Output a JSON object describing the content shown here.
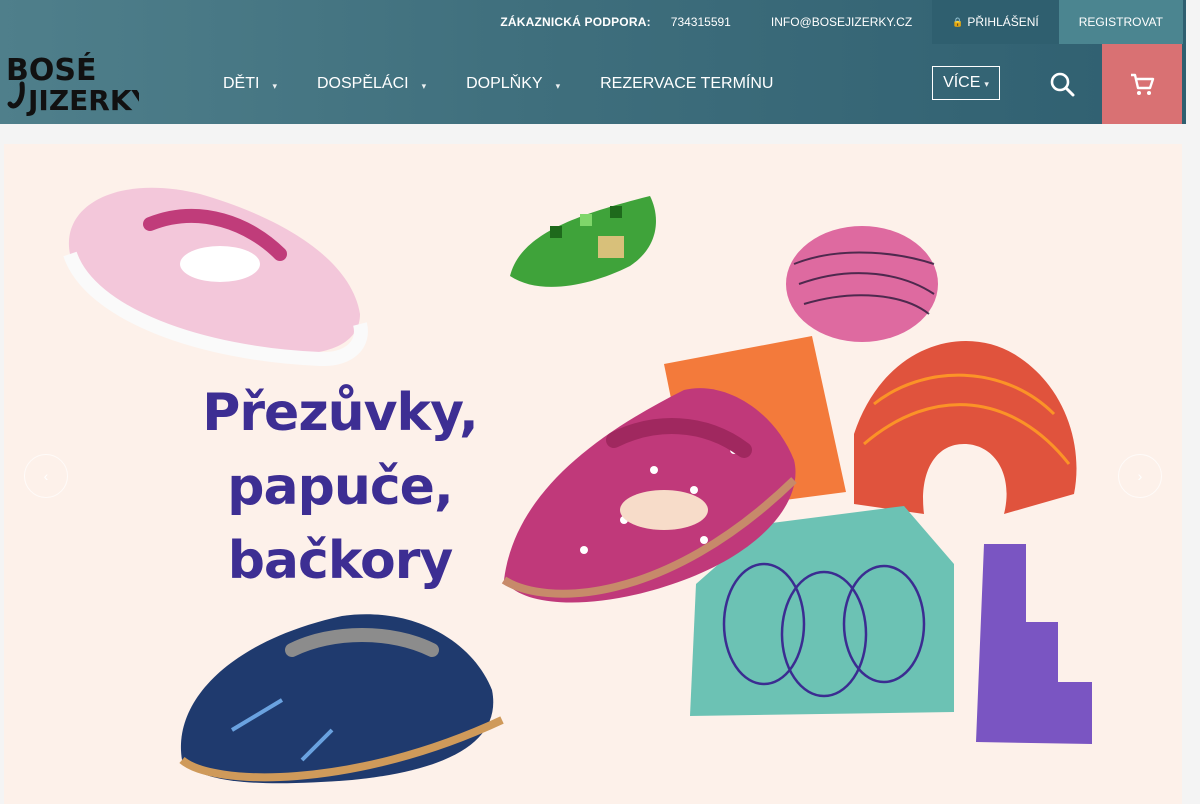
{
  "topbar": {
    "support_label": "ZÁKAZNICKÁ PODPORA:",
    "phone": "734315591",
    "email": "INFO@BOSEJIZERKY.CZ",
    "login": "PŘIHLÁŠENÍ",
    "register": "REGISTROVAT"
  },
  "logo": {
    "line1": "BOSÉ",
    "line2": "JIZERKY"
  },
  "nav": {
    "items": [
      {
        "label": "DĚTI"
      },
      {
        "label": "DOSPĚLÁCI"
      },
      {
        "label": "DOPLŇKY"
      },
      {
        "label": "REZERVACE TERMÍNU"
      }
    ],
    "more": "VÍCE"
  },
  "hero": {
    "line1": "Přezůvky,",
    "line2": "papuče,",
    "line3": "bačkory"
  },
  "colors": {
    "header": "#3f6f7d",
    "cart": "#d97173",
    "headline": "#3d2e93",
    "hero_bg": "#fdf1ea"
  }
}
